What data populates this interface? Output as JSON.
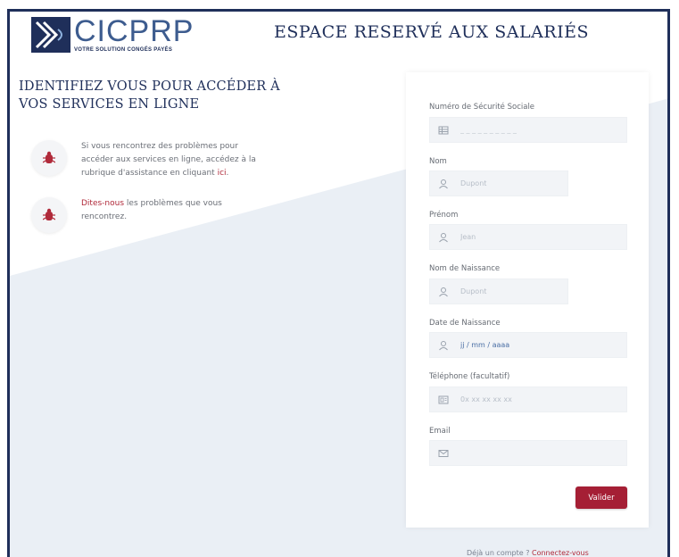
{
  "header": {
    "logo_text": "CICPRP",
    "logo_tagline": "VOTRE SOLUTION CONGÉS PAYÉS",
    "title": "ESPACE RESERVÉ AUX SALARIÉS"
  },
  "left": {
    "title": "IDENTIFIEZ VOUS POUR ACCÉDER À VOS SERVICES EN LIGNE",
    "help1_text": "Si vous rencontrez des problèmes pour accéder aux services en ligne, accédez à la rubrique d'assistance en cliquant ",
    "help1_link": "ici",
    "help1_end": ".",
    "help2_link": "Dites-nous",
    "help2_text": " les problèmes que vous rencontrez."
  },
  "form": {
    "nss_label": "Numéro de Sécurité Sociale",
    "nss_placeholder": "_ _ _ _ _ _ _ _ _ _",
    "nom_label": "Nom",
    "nom_placeholder": "Dupont",
    "prenom_label": "Prénom",
    "prenom_placeholder": "Jean",
    "naissance_nom_label": "Nom de Naissance",
    "naissance_nom_placeholder": "Dupont",
    "date_label": "Date de Naissance",
    "date_placeholder": "jj / mm / aaaa",
    "tel_label": "Téléphone (facultatif)",
    "tel_placeholder": "0x xx xx xx xx",
    "email_label": "Email",
    "email_placeholder": "",
    "submit_label": "Valider"
  },
  "footer": {
    "account_text": "Déjà un compte ? ",
    "account_link": "Connectez-vous"
  },
  "colors": {
    "brand_navy": "#1f2f5a",
    "accent_red": "#a51f35",
    "background": "#eaeff5"
  }
}
